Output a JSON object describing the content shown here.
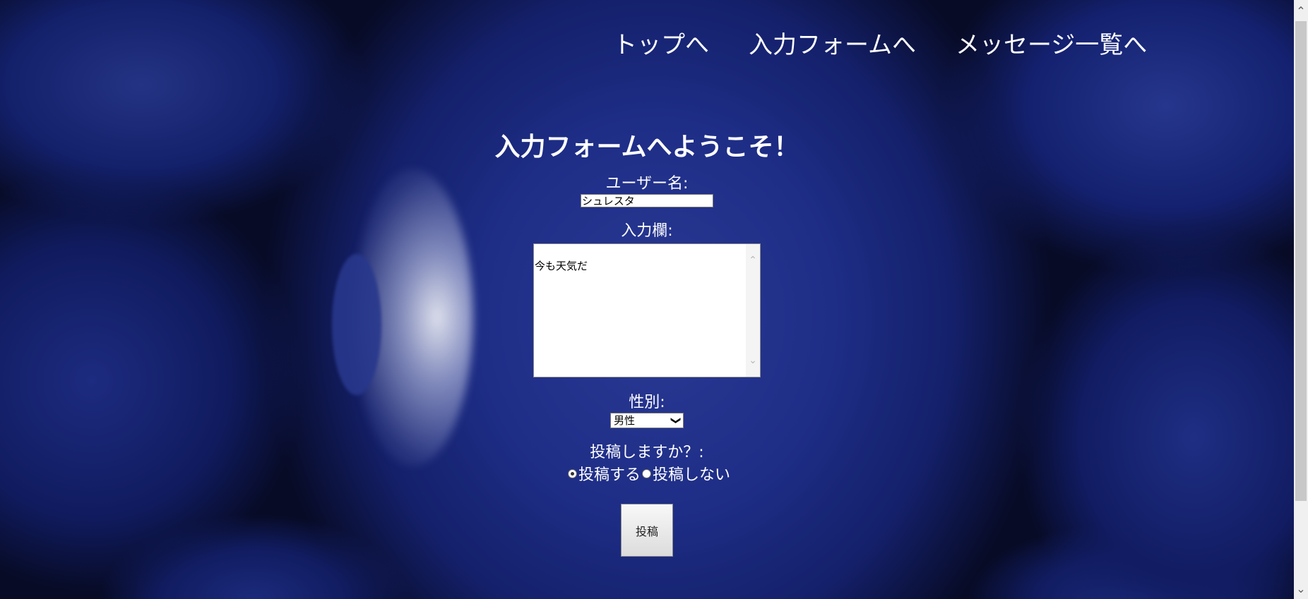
{
  "nav": {
    "items": [
      {
        "label": "トップへ"
      },
      {
        "label": "入力フォームへ"
      },
      {
        "label": "メッセージ一覧へ"
      }
    ]
  },
  "form": {
    "title": "入力フォームへようこそ！",
    "username_label": "ユーザー名:",
    "username_value": "シュレスタ",
    "memo_label": "入力欄:",
    "memo_value": "今も天気だ",
    "gender_label": "性別:",
    "gender_selected": "男性",
    "post_label": "投稿しますか？:",
    "radio_yes": "投稿する",
    "radio_no": "投稿しない",
    "submit_label": "投稿"
  },
  "icons": {
    "chevron_down": "chevron-down-icon",
    "scroll_up": "scroll-up-icon",
    "scroll_down": "scroll-down-icon"
  },
  "colors": {
    "background": "#1e2d86",
    "text": "#ffffff"
  }
}
